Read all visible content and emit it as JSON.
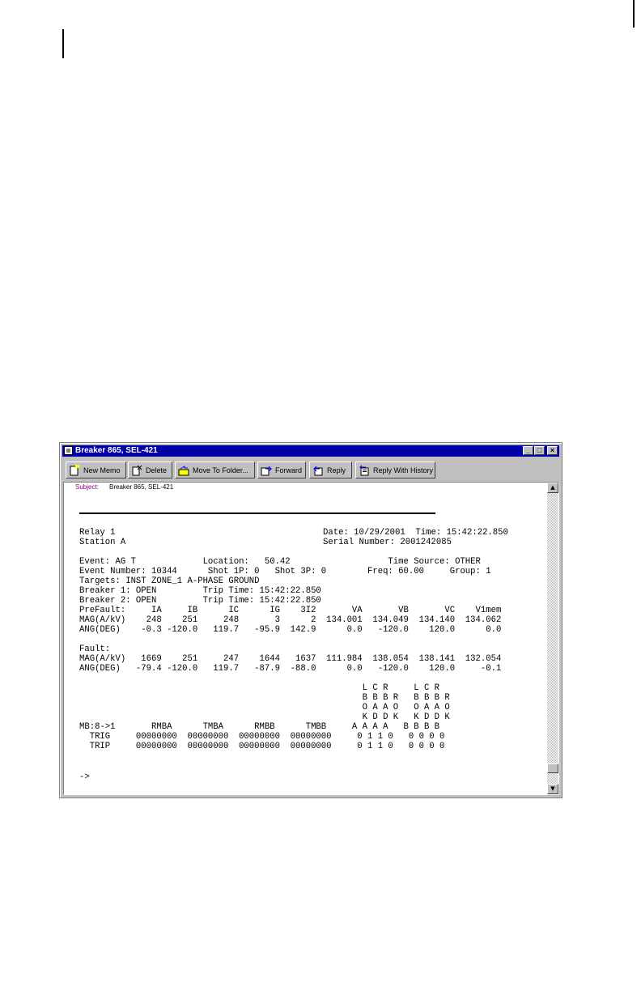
{
  "window": {
    "title": "Breaker 865, SEL-421",
    "controls": {
      "minimize": "_",
      "maximize": "□",
      "close": "×"
    }
  },
  "toolbar": {
    "buttons": [
      {
        "label": "New Memo",
        "icon": "new-memo-icon"
      },
      {
        "label": "Delete",
        "icon": "delete-icon"
      },
      {
        "label": "Move To Folder...",
        "icon": "move-folder-icon"
      },
      {
        "label": "Forward",
        "icon": "forward-icon"
      },
      {
        "label": "Reply",
        "icon": "reply-icon"
      },
      {
        "label": "Reply With History",
        "icon": "reply-history-icon"
      }
    ]
  },
  "memo": {
    "subject_label": "Subject:",
    "subject_value": "Breaker 865, SEL-421",
    "report": {
      "relay": "Relay 1",
      "station": "Station A",
      "date_time": "Date: 10/29/2001  Time: 15:42:22.850",
      "serial": "Serial Number: 2001242085",
      "event_line": "Event: AG T             Location:   50.42                   Time Source: OTHER",
      "event_number_line": "Event Number: 10344      Shot 1P: 0   Shot 3P: 0        Freq: 60.00     Group: 1",
      "targets": "Targets: INST ZONE_1 A-PHASE GROUND",
      "breaker1": "Breaker 1: OPEN         Trip Time: 15:42:22.850",
      "breaker2": "Breaker 2: OPEN         Trip Time: 15:42:22.850",
      "prefault_header": "PreFault:     IA     IB      IC      IG    3I2       VA       VB       VC    V1mem",
      "prefault_mag": "MAG(A/kV)    248    251     248       3      2  134.001  134.049  134.140  134.062",
      "prefault_ang": "ANG(DEG)    -0.3 -120.0   119.7   -95.9  142.9      0.0   -120.0    120.0      0.0",
      "fault_label": "Fault:",
      "fault_mag": "MAG(A/kV)   1669    251     247    1644   1637  111.984  138.054  138.141  132.054",
      "fault_ang": "ANG(DEG)   -79.4 -120.0   119.7   -87.9  -88.0      0.0   -120.0    120.0     -0.1",
      "mb_header1": "                                                       L C R     L C R",
      "mb_header2": "                                                       B B B R   B B B R",
      "mb_header3": "                                                       O A A O   O A A O",
      "mb_header4": "                                                       K D D K   K D D K",
      "mb_columns": "MB:8->1       RMBA      TMBA      RMBB      TMBB     A A A A   B B B B",
      "mb_trig": "  TRIG     00000000  00000000  00000000  00000000     0 1 1 0   0 0 0 0",
      "mb_trip": "  TRIP     00000000  00000000  00000000  00000000     0 1 1 0   0 0 0 0",
      "prompt": "->"
    }
  },
  "scrollbar": {
    "up": "▲",
    "down": "▼"
  }
}
